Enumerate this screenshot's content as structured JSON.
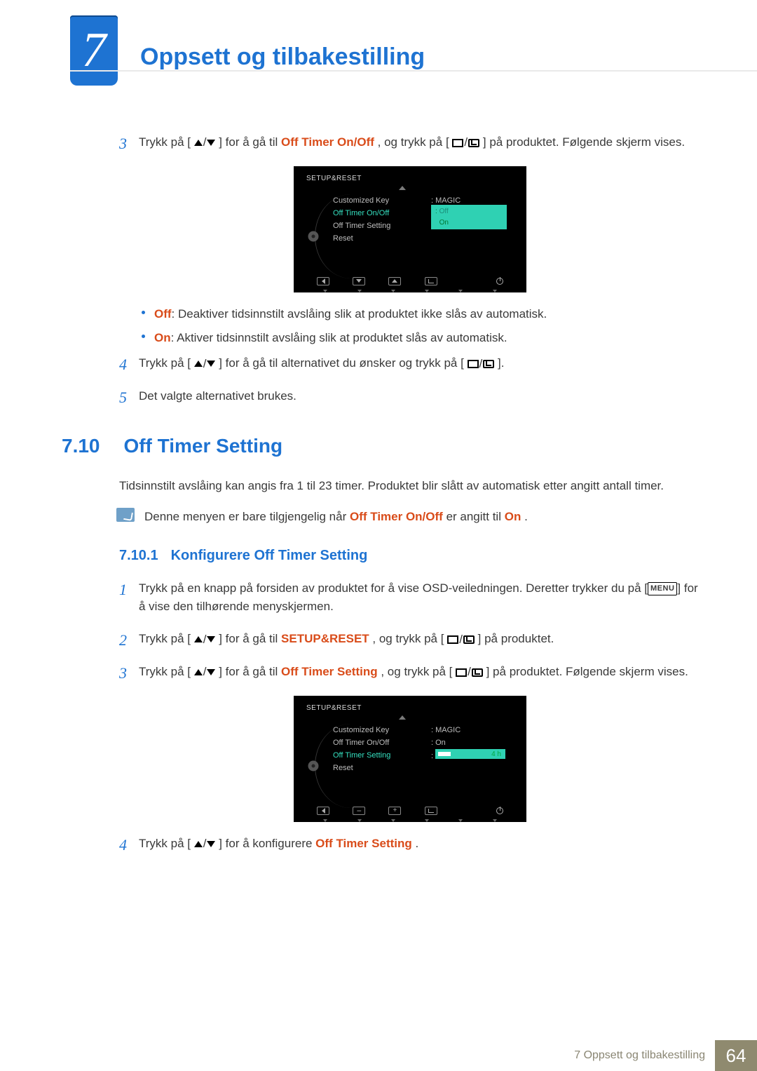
{
  "chapter": {
    "number": "7",
    "title": "Oppsett og tilbakestilling"
  },
  "step3": {
    "num": "3",
    "t1": "Trykk på [",
    "t2": "] for å gå til ",
    "off_timer_onoff": "Off Timer On/Off",
    "t3": ", og trykk på [",
    "t4": "] på produktet. Følgende skjerm vises."
  },
  "osd1": {
    "title": "SETUP&RESET",
    "menu": [
      "Customized Key",
      "Off Timer On/Off",
      "Off Timer Setting",
      "Reset"
    ],
    "val_customized": ": MAGIC",
    "sel_off": "Off",
    "sel_on": "On"
  },
  "bullets": {
    "off_label": "Off",
    "off_text": ": Deaktiver tidsinnstilt avslåing slik at produktet ikke slås av automatisk.",
    "on_label": "On",
    "on_text": ": Aktiver tidsinnstilt avslåing slik at produktet slås av automatisk."
  },
  "step4a": {
    "num": "4",
    "t1": "Trykk på [",
    "t2": "] for å gå til alternativet du ønsker og trykk på [",
    "t3": "]."
  },
  "step5a": {
    "num": "5",
    "text": "Det valgte alternativet brukes."
  },
  "section710": {
    "num": "7.10",
    "title": "Off Timer Setting"
  },
  "section710_intro": "Tidsinnstilt avslåing kan angis fra 1 til 23 timer. Produktet blir slått av automatisk etter angitt antall timer.",
  "section710_note": {
    "t1": "Denne menyen er bare tilgjengelig når ",
    "bold1": "Off Timer On/Off",
    "t2": " er angitt til ",
    "bold2": "On",
    "t3": "."
  },
  "subsection7101": {
    "num": "7.10.1",
    "title": "Konfigurere Off Timer Setting"
  },
  "s1": {
    "num": "1",
    "t1": "Trykk på en knapp på forsiden av produktet for å vise OSD-veiledningen. Deretter trykker du på [",
    "menu": "MENU",
    "t2": "] for å vise den tilhørende menyskjermen."
  },
  "s2": {
    "num": "2",
    "t1": "Trykk på [",
    "t2": "] for å gå til ",
    "bold": "SETUP&RESET",
    "t3": ", og trykk på [",
    "t4": "] på produktet."
  },
  "s3": {
    "num": "3",
    "t1": "Trykk på [",
    "t2": "] for å gå til ",
    "bold": "Off Timer Setting",
    "t3": ", og trykk på [",
    "t4": "] på produktet. Følgende skjerm vises."
  },
  "osd2": {
    "title": "SETUP&RESET",
    "menu": [
      "Customized Key",
      "Off Timer On/Off",
      "Off Timer Setting",
      "Reset"
    ],
    "val_customized": ": MAGIC",
    "val_onoff": ": On",
    "slider_val": "4 h",
    "slider_fill_pct": 18
  },
  "s4": {
    "num": "4",
    "t1": "Trykk på [",
    "t2": "] for å konfigurere ",
    "bold": "Off Timer Setting",
    "t3": "."
  },
  "footer": {
    "label": "7 Oppsett og tilbakestilling",
    "page": "64"
  },
  "chart_data": {
    "type": "bar",
    "title": "Off Timer Setting slider",
    "categories": [
      "hours"
    ],
    "values": [
      4
    ],
    "xlabel": "",
    "ylabel": "hours",
    "ylim": [
      1,
      23
    ]
  }
}
